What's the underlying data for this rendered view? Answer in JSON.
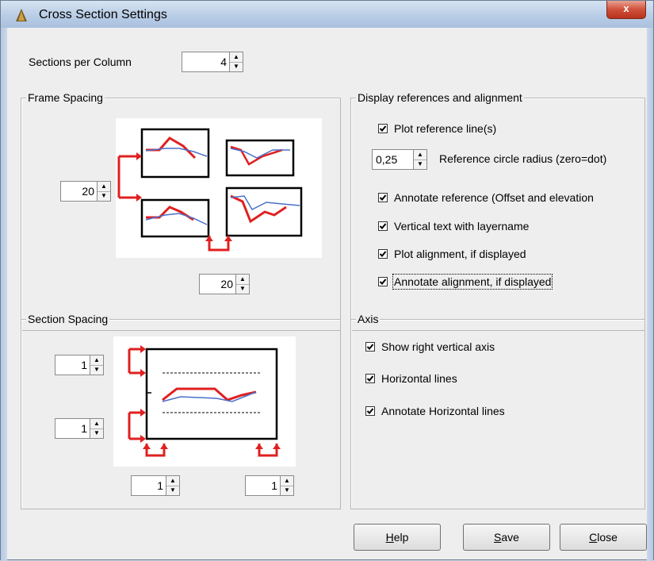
{
  "window": {
    "title": "Cross Section Settings",
    "close_label": "x"
  },
  "sections_per_column": {
    "label": "Sections per Column",
    "value": "4"
  },
  "frame_spacing": {
    "title": "Frame Spacing",
    "vertical_value": "20",
    "horizontal_value": "20"
  },
  "section_spacing": {
    "title": "Section Spacing",
    "top_value": "1",
    "bottom_value": "1",
    "left_value": "1",
    "right_value": "1"
  },
  "display": {
    "title": "Display references and alignment",
    "plot_reference": "Plot reference line(s)",
    "radius_value": "0,25",
    "radius_label": "Reference circle radius (zero=dot)",
    "annotate_reference": "Annotate reference (Offset and elevation",
    "vertical_text": "Vertical text with layername",
    "plot_alignment": "Plot alignment, if displayed",
    "annotate_alignment": "Annotate alignment, if displayed"
  },
  "axis": {
    "title": "Axis",
    "show_right": "Show right vertical axis",
    "horizontal_lines": "Horizontal lines",
    "annotate_horizontal": "Annotate Horizontal lines"
  },
  "buttons": {
    "help_u": "H",
    "help_rest": "elp",
    "save_u": "S",
    "save_rest": "ave",
    "close_u": "C",
    "close_rest": "lose"
  },
  "colors": {
    "accent_red": "#e02020",
    "line_blue": "#4a6fc8",
    "titlebar": "#b9cde6"
  },
  "icons": {
    "app": "cone-icon",
    "spin_up": "arrow-up-icon",
    "spin_down": "arrow-down-icon",
    "check": "checkmark-icon"
  }
}
